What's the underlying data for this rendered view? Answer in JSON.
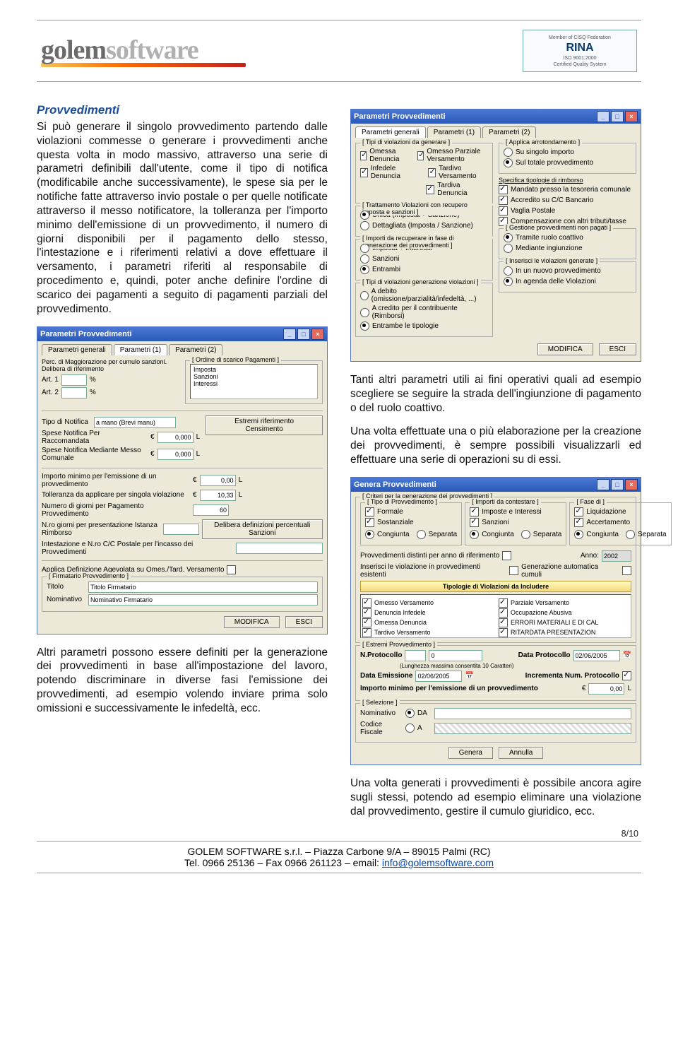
{
  "header": {
    "logo_part1": "golem",
    "logo_part2": "software",
    "badge_title": "RINA",
    "badge_sub1": "ISO 9001:2000",
    "badge_sub2": "Certified Quality System",
    "badge_top": "Member of CISQ Federation"
  },
  "left": {
    "heading": "Provvedimenti",
    "para1": "Si può generare il singolo provvedimento partendo dalle violazioni commesse o generare i provvedimenti anche questa volta in modo massivo, attraverso una serie di parametri definibili dall'utente, come il tipo di notifica (modificabile anche successivamente), le spese sia per le notifiche fatte attraverso invio postale o per quelle notificate attraverso il messo notificatore, la tolleranza per l'importo minimo dell'emissione di un provvedimento, il numero di giorni disponibili per il pagamento dello stesso, l'intestazione e i riferimenti relativi a dove effettuare il versamento, i parametri riferiti al responsabile di procedimento e, quindi, poter anche definire l'ordine di scarico dei pagamenti a seguito di pagamenti parziali del provvedimento.",
    "para_bottom": "Altri parametri possono essere definiti per la generazione dei provvedimenti in base all'impostazione del lavoro, potendo discriminare in diverse fasi l'emissione dei provvedimenti, ad esempio volendo inviare prima solo omissioni e successivamente le infedeltà, ecc."
  },
  "right": {
    "para1": "Tanti altri parametri utili ai fini operativi quali ad esempio scegliere se seguire la strada dell'ingiunzione di pagamento o del ruolo coattivo.",
    "para2": "Una volta effettuate una o più elaborazione per la creazione dei provvedimenti, è sempre possibili visualizzarli ed effettuare una serie di operazioni su di essi.",
    "para_bottom": "Una volta generati i provvedimenti è possibile ancora agire sugli stessi, potendo ad esempio eliminare una violazione dal provvedimento, gestire il cumulo giuridico, ecc."
  },
  "win1": {
    "title": "Parametri Provvedimenti",
    "tabs": [
      "Parametri generali",
      "Parametri (1)",
      "Parametri (2)"
    ],
    "tipi_title": "[ Tipi di violazioni da generare ]",
    "tipi": [
      "Omessa Denuncia",
      "Infedele Denuncia",
      "Omesso Parziale Versamento",
      "Tardivo Versamento",
      "Tardiva Denuncia"
    ],
    "arrot_title": "[ Applica arrotondamento ]",
    "arrot": [
      "Su singolo importo",
      "Sul totale provvedimento"
    ],
    "tratt_title": "[ Trattamento Violazioni con recupero imposta e sanzioni ]",
    "tratt": [
      "Unica (Imposta + Sanzione)",
      "Dettagliata (Imposta / Sanzione)"
    ],
    "rimb_title": "Specifica tipologie di rimborso",
    "rimb": [
      "Mandato presso la tesoreria comunale",
      "Accredito su C/C Bancario",
      "Vaglia Postale",
      "Compensazione con altri tributi/tasse"
    ],
    "recup_title": "[ Importi da recuperare in fase di generazione dei provvedimenti ]",
    "recup": [
      "Imposta + Interessi",
      "Sanzioni",
      "Entrambi"
    ],
    "gest_title": "[ Gestione provvedimenti non pagati ]",
    "gest": [
      "Tramite ruolo coattivo",
      "Mediante ingiunzione"
    ],
    "gen_title": "[ Tipi di violazioni generazione violazioni ]",
    "gen": [
      "A debito (omissione/parzialità/infedeltà, ...)",
      "A credito per il contribuente (Rimborsi)",
      "Entrambe le tipologie"
    ],
    "ins_title": "[ Inserisci le violazioni generate ]",
    "ins": [
      "In un nuovo provvedimento",
      "In agenda delle Violazioni"
    ],
    "modifica": "MODIFICA",
    "esci": "ESCI"
  },
  "win2": {
    "title": "Parametri Provvedimenti",
    "tabs": [
      "Parametri generali",
      "Parametri (1)",
      "Parametri (2)"
    ],
    "perc_title": "Perc. di Maggiorazione per cumulo sanzioni. Delibera di riferimento",
    "art1": "Art. 1",
    "art2": "Art. 2",
    "pct": "%",
    "ord_title": "[ Ordine di scarico Pagamenti ]",
    "ord_items": [
      "Imposta",
      "Sanzioni",
      "Interessi"
    ],
    "tipo_notifica_lbl": "Tipo di Notifica",
    "tipo_notifica_val": "a mano (Brevi manu)",
    "estremi": "Estremi riferimento Censimento",
    "spese_racc_lbl": "Spese Notifica Per Raccomandata",
    "spese_racc_val": "0,000",
    "spese_messo_lbl": "Spese Notifica Mediante Messo Comunale",
    "spese_messo_val": "0,000",
    "imp_min_lbl": "Importo minimo per l'emissione di un provvedimento",
    "imp_min_val": "0,00",
    "toll_lbl": "Tolleranza da applicare per singola violazione",
    "toll_val": "10,33",
    "gg_pag_lbl": "Numero di giorni per Pagamento Provvedimento",
    "gg_pag_val": "60",
    "gg_rimb_lbl": "N.ro giorni per presentazione Istanza Rimborso",
    "intest_lbl": "Intestazione e N.ro C/C Postale per l'incasso dei Provvedimenti",
    "delibera_btn": "Delibera definizioni percentuali Sanzioni",
    "applica_lbl": "Applica Definizione Agevolata su Omes./Tard. Versamento",
    "firm_title": "[ Firmatario Provvedimento ]",
    "titolo_lbl": "Titolo",
    "titolo_val": "Titolo Firmatario",
    "nom_lbl": "Nominativo",
    "nom_val": "Nominativo Firmatario",
    "cur": "€",
    "L": "L",
    "modifica": "MODIFICA",
    "esci": "ESCI"
  },
  "win3": {
    "title": "Genera Provvedimenti",
    "crit_title": "[ Criteri per la generazione dei provvedimenti ]",
    "tipo_title": "[ Tipo di Provvedimento ]",
    "tipo": [
      "Formale",
      "Sostanziale"
    ],
    "imp_title": "[ Importi da contestare ]",
    "imp": [
      "Imposte e Interessi",
      "Sanzioni"
    ],
    "fase_title": "[ Fase di ]",
    "fase": [
      "Liquidazione",
      "Accertamento"
    ],
    "con_sep": [
      "Congiunta",
      "Separata"
    ],
    "pdistinti": "Provvedimenti distinti per anno di riferimento",
    "anno_lbl": "Anno:",
    "anno_val": "2002",
    "ins_esist": "Inserisci le violazione in provvedimenti esistenti",
    "gen_auto": "Generazione automatica cumuli",
    "tipol_hdr": "Tipologie di Violazioni da Includere",
    "tipol": [
      "Omesso Versamento",
      "Denuncia Infedele",
      "Omessa Denuncia",
      "Tardivo Versamento",
      "Parziale Versamento",
      "Occupazione Abusiva",
      "ERRORI MATERIALI E DI CAL",
      "RITARDATA PRESENTAZION"
    ],
    "estremi_title": "[ Estremi Provvedimento ]",
    "nprot_lbl": "N.Protocollo",
    "nprot_val": "0",
    "nprot_hint": "(Lunghezza massima consentita 10 Caratteri)",
    "dprot_lbl": "Data Protocollo",
    "dprot_val": "02/06/2005",
    "demis_lbl": "Data Emissione",
    "demis_val": "02/06/2005",
    "incr_lbl": "Incrementa Num. Protocollo",
    "impmin_lbl": "Importo minimo per l'emissione di un provvedimento",
    "impmin_val": "0,00",
    "sel_title": "[ Selezione ]",
    "nominativo": "Nominativo",
    "codfisc": "Codice Fiscale",
    "da": "DA",
    "a": "A",
    "genera": "Genera",
    "annulla": "Annulla",
    "cur": "€",
    "L": "L"
  },
  "footer": {
    "line1": "GOLEM SOFTWARE s.r.l. – Piazza Carbone 9/A – 89015 Palmi (RC)",
    "line2_a": "Tel. 0966 25136 – Fax 0966 261123 – email: ",
    "email": "info@golemsoftware.com",
    "page": "8/10"
  }
}
